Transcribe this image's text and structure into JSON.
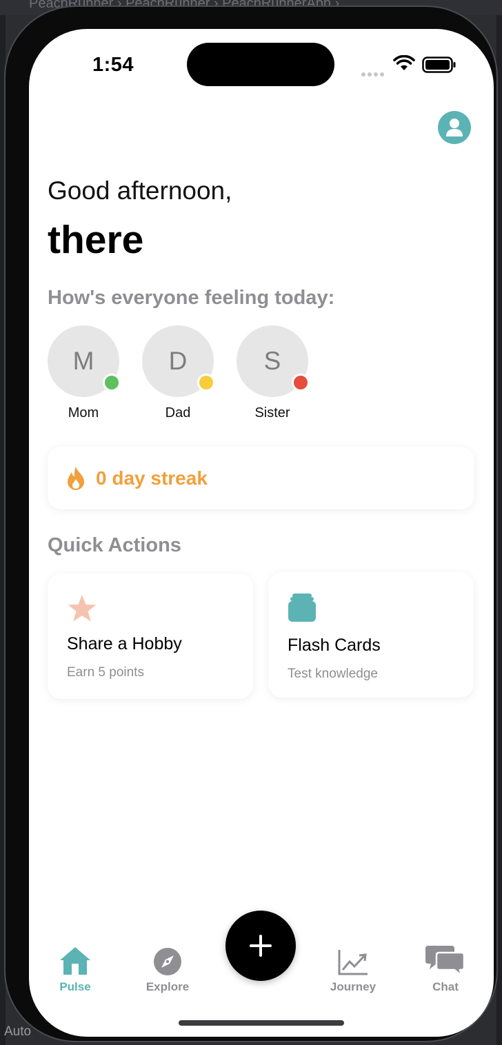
{
  "window": {
    "breadcrumb": "PeachRunner  ›    PeachRunner  ›    PeachRunnerApp  ›",
    "bottom_label": "Auto"
  },
  "status_bar": {
    "time": "1:54"
  },
  "greeting": {
    "line1": "Good afternoon,",
    "name": "there"
  },
  "feelings": {
    "title": "How's everyone feeling today:",
    "members": [
      {
        "initial": "M",
        "name": "Mom",
        "status_color": "#5ec05f"
      },
      {
        "initial": "D",
        "name": "Dad",
        "status_color": "#f6cd3b"
      },
      {
        "initial": "S",
        "name": "Sister",
        "status_color": "#e74c3c"
      }
    ]
  },
  "streak": {
    "text": "0 day streak",
    "icon": "flame-icon",
    "color": "#f0a03c"
  },
  "quick_actions": {
    "title": "Quick Actions",
    "items": [
      {
        "title": "Share a Hobby",
        "subtitle": "Earn 5 points",
        "icon": "star-icon"
      },
      {
        "title": "Flash Cards",
        "subtitle": "Test knowledge",
        "icon": "card-stack-icon"
      }
    ]
  },
  "tab_bar": {
    "tabs": [
      {
        "label": "Pulse",
        "icon": "house-icon",
        "active": true
      },
      {
        "label": "Explore",
        "icon": "compass-icon",
        "active": false
      },
      {
        "label": "Journey",
        "icon": "chart-line-icon",
        "active": false
      },
      {
        "label": "Chat",
        "icon": "chat-bubbles-icon",
        "active": false
      }
    ],
    "fab_icon": "plus-icon"
  },
  "colors": {
    "accent": "#5bb3b4",
    "streak": "#f0a03c",
    "star": "#f6c3ae"
  }
}
